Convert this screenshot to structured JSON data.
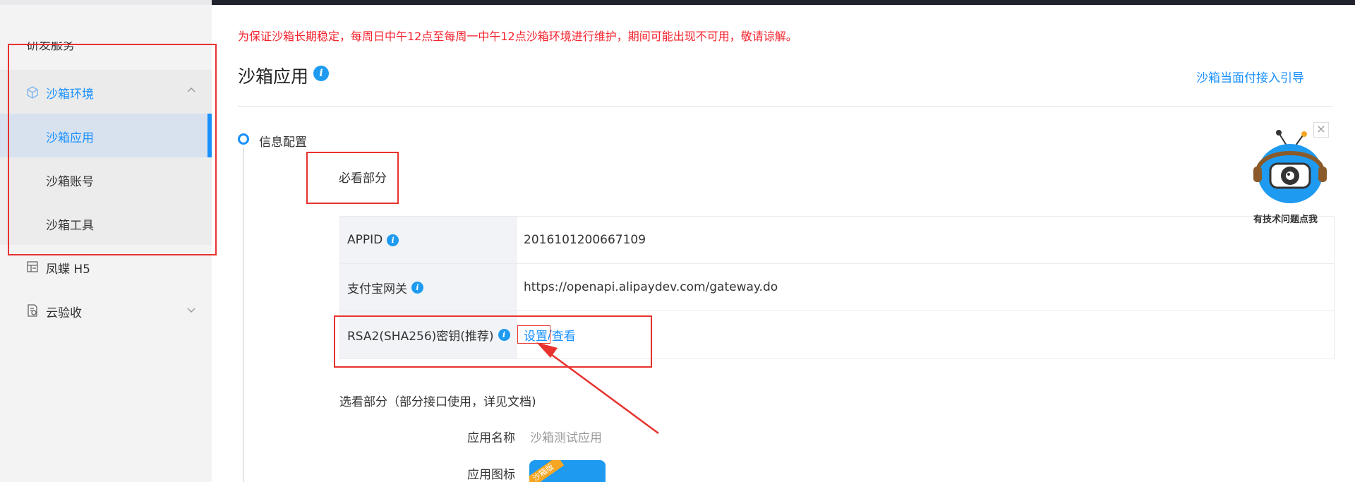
{
  "sidebar": {
    "cut_item": "研发服务",
    "group": {
      "label": "沙箱环境",
      "icon": "cube-icon",
      "expanded": true
    },
    "sub_items": [
      {
        "label": "沙箱应用",
        "active": true
      },
      {
        "label": "沙箱账号",
        "active": false
      },
      {
        "label": "沙箱工具",
        "active": false
      }
    ],
    "items": [
      {
        "label": "凤蝶 H5",
        "icon": "layout-icon"
      },
      {
        "label": "云验收",
        "icon": "document-check-icon",
        "has_chevron": true
      }
    ]
  },
  "notice": "为保证沙箱长期稳定，每周日中午12点至每周一中午12点沙箱环境进行维护，期间可能出现不可用，敬请谅解。",
  "page": {
    "title": "沙箱应用",
    "guide_link": "沙箱当面付接入引导"
  },
  "section": {
    "label": "信息配置",
    "must_label": "必看部分",
    "rows": [
      {
        "key": "APPID",
        "value": "2016101200667109"
      },
      {
        "key": "支付宝网关",
        "value": "https://openapi.alipaydev.com/gateway.do"
      },
      {
        "key": "RSA2(SHA256)密钥(推荐)",
        "set_link": "设置",
        "sep": "/",
        "view_link": "查看"
      }
    ],
    "optional_label": "选看部分（部分接口使用，详见文档)",
    "fields": [
      {
        "label": "应用名称",
        "value": "沙箱测试应用"
      },
      {
        "label": "应用图标",
        "icon_tag": "沙箱版"
      }
    ]
  },
  "robot": {
    "text": "有技术问题点我",
    "close": "×"
  },
  "colors": {
    "accent": "#1890ff",
    "notice": "#f5222d",
    "annotation": "#e8322e"
  }
}
